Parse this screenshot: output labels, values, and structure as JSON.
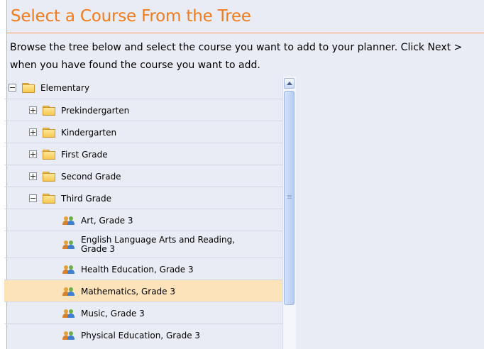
{
  "header": {
    "title": "Select a Course From the Tree",
    "instructions": "Browse the tree below and select the course you want to add to your planner. Click Next > when you have found the course you want to add."
  },
  "tree": {
    "root": {
      "label": "Elementary",
      "expanded": true
    },
    "grades": [
      {
        "label": "Prekindergarten",
        "expanded": false
      },
      {
        "label": "Kindergarten",
        "expanded": false
      },
      {
        "label": "First Grade",
        "expanded": false
      },
      {
        "label": "Second Grade",
        "expanded": false
      },
      {
        "label": "Third Grade",
        "expanded": true
      }
    ],
    "courses": [
      {
        "label": "Art, Grade 3",
        "selected": false
      },
      {
        "label": "English Language Arts and Reading, Grade 3",
        "selected": false
      },
      {
        "label": "Health Education, Grade 3",
        "selected": false
      },
      {
        "label": "Mathematics, Grade 3",
        "selected": true
      },
      {
        "label": "Music, Grade 3",
        "selected": false
      },
      {
        "label": "Physical Education, Grade 3",
        "selected": false
      }
    ]
  },
  "colors": {
    "title": "#f07c1c",
    "selected_row": "#fde3b9",
    "panel_background": "#e9ecf4"
  },
  "icons": {
    "collapse": "minus-box-icon",
    "expand": "plus-box-icon",
    "folder": "folder-icon",
    "course": "people-icon"
  }
}
